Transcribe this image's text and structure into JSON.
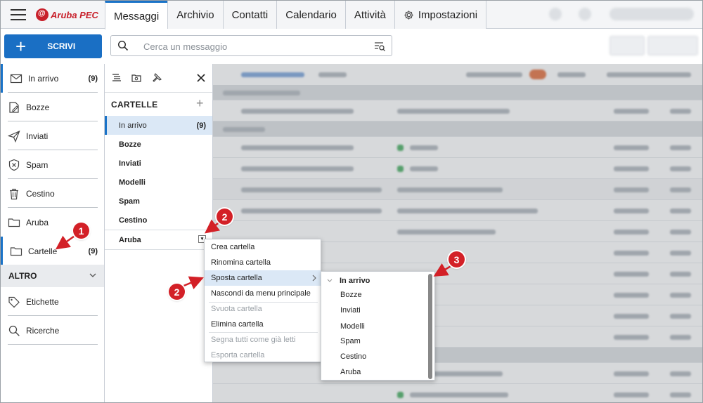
{
  "app": {
    "logo_text": "Aruba PEC"
  },
  "tabs": [
    {
      "label": "Messaggi"
    },
    {
      "label": "Archivio"
    },
    {
      "label": "Contatti"
    },
    {
      "label": "Calendario"
    },
    {
      "label": "Attività"
    },
    {
      "label": "Impostazioni"
    }
  ],
  "toolbar": {
    "compose_label": "SCRIVI",
    "search_placeholder": "Cerca un messaggio"
  },
  "sidebar": {
    "items": [
      {
        "label": "In arrivo",
        "count": "(9)"
      },
      {
        "label": "Bozze"
      },
      {
        "label": "Inviati"
      },
      {
        "label": "Spam"
      },
      {
        "label": "Cestino"
      },
      {
        "label": "Aruba"
      },
      {
        "label": "Cartelle",
        "count": "(9)"
      }
    ],
    "section_other": "ALTRO",
    "other_items": [
      {
        "label": "Etichette"
      },
      {
        "label": "Ricerche"
      }
    ]
  },
  "folders": {
    "heading": "CARTELLE",
    "items": [
      {
        "label": "In arrivo",
        "count": "(9)"
      },
      {
        "label": "Bozze"
      },
      {
        "label": "Inviati"
      },
      {
        "label": "Modelli"
      },
      {
        "label": "Spam"
      },
      {
        "label": "Cestino"
      },
      {
        "label": "Aruba"
      }
    ]
  },
  "context_menu": {
    "items": [
      {
        "label": "Crea cartella"
      },
      {
        "label": "Rinomina cartella"
      },
      {
        "label": "Sposta cartella"
      },
      {
        "label": "Nascondi da menu principale"
      },
      {
        "label": "Svuota cartella"
      },
      {
        "label": "Elimina cartella"
      },
      {
        "label": "Segna tutti come già letti"
      },
      {
        "label": "Esporta cartella"
      }
    ]
  },
  "submenu": {
    "items": [
      {
        "label": "In arrivo"
      },
      {
        "label": "Bozze"
      },
      {
        "label": "Inviati"
      },
      {
        "label": "Modelli"
      },
      {
        "label": "Spam"
      },
      {
        "label": "Cestino"
      },
      {
        "label": "Aruba"
      }
    ]
  },
  "callouts": [
    {
      "label": "1"
    },
    {
      "label": "2"
    },
    {
      "label": "2"
    },
    {
      "label": "3"
    }
  ],
  "colors": {
    "accent": "#1a6fc4",
    "callout": "#d32027",
    "selection": "#dbe8f6"
  }
}
